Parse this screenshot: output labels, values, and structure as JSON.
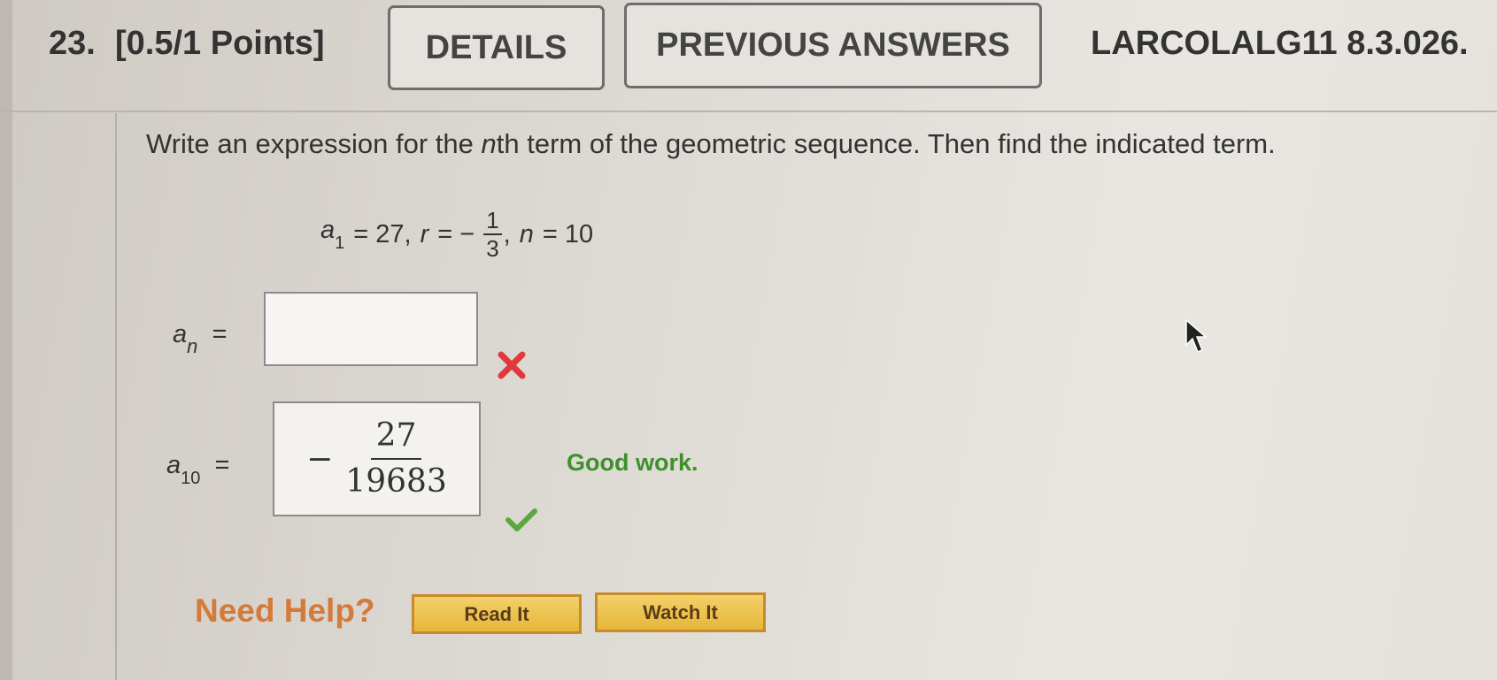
{
  "header": {
    "question_number": "23.",
    "points": "[0.5/1 Points]",
    "details_label": "DETAILS",
    "previous_answers_label": "PREVIOUS ANSWERS",
    "problem_id": "LARCOLALG11 8.3.026."
  },
  "problem": {
    "prompt_before": "Write an expression for the ",
    "prompt_n": "n",
    "prompt_after": "th term of the geometric sequence. Then find the indicated term.",
    "given": {
      "a_var": "a",
      "a_sub": "1",
      "a_eq": "= 27,",
      "r_var": "r",
      "r_eq": "= −",
      "r_num": "1",
      "r_den": "3",
      "r_comma": ",",
      "n_var": "n",
      "n_eq": "= 10"
    }
  },
  "answers": {
    "an_var": "a",
    "an_sub": "n",
    "an_eq": "=",
    "an_value": "",
    "an_status_icon": "x-icon",
    "a10_var": "a",
    "a10_sub": "10",
    "a10_eq": "=",
    "a10_sign": "−",
    "a10_num": "27",
    "a10_den": "19683",
    "a10_status_icon": "check-icon",
    "feedback": "Good work."
  },
  "help": {
    "label": "Need Help?",
    "read_it": "Read It",
    "watch_it": "Watch It"
  },
  "colors": {
    "incorrect": "#e0393b",
    "correct": "#5aa83c",
    "help_text": "#d47a3a",
    "help_button": "#e7b63a"
  }
}
